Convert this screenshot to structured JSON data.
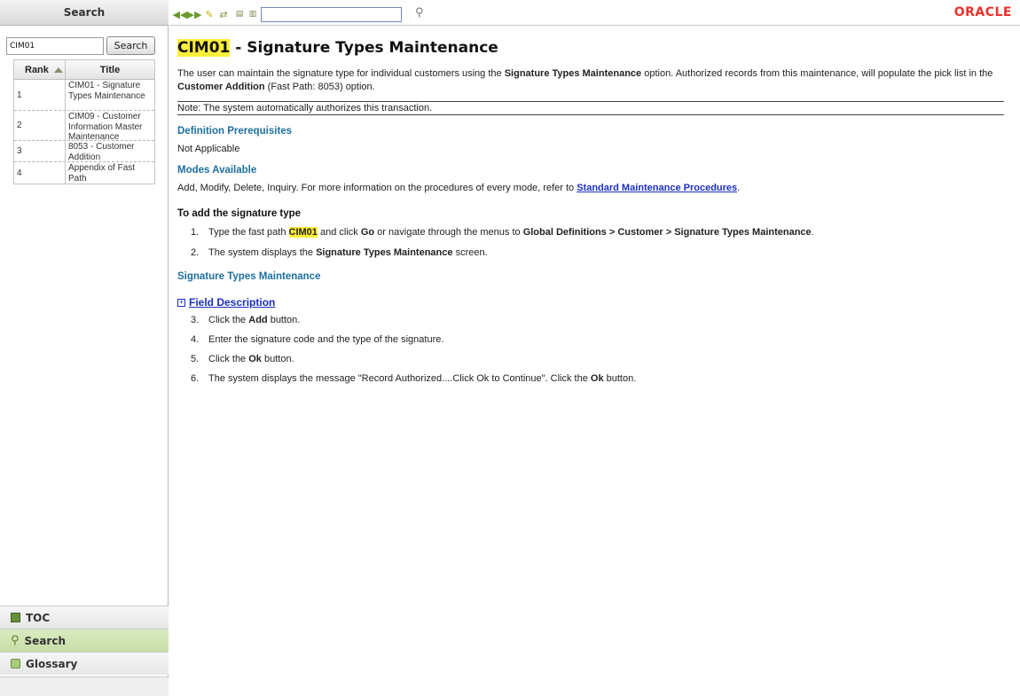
{
  "left_pane": {
    "header": "Search",
    "search_value": "CIM01",
    "search_button": "Search",
    "table": {
      "col_rank": "Rank",
      "col_title": "Title",
      "rows": [
        {
          "rank": "1",
          "title": "CIM01 - Signature Types Maintenance"
        },
        {
          "rank": "2",
          "title": "CIM09 - Customer Information Master Maintenance"
        },
        {
          "rank": "3",
          "title": "8053 - Customer Addition"
        },
        {
          "rank": "4",
          "title": "Appendix of Fast Path"
        }
      ]
    },
    "tabs": [
      {
        "label": "TOC",
        "active": false
      },
      {
        "label": "Search",
        "active": true
      },
      {
        "label": "Glossary",
        "active": false
      }
    ]
  },
  "toolbar": {
    "icons": [
      "previous-topic-icon",
      "next-topic-icon",
      "highlight-icon",
      "sync-toc-icon",
      "expand-icon",
      "collapse-icon",
      "find-icon"
    ],
    "find_value": "",
    "logo": "ORACLE",
    "logo_color": "#e8332a"
  },
  "content": {
    "title_code": "CIM01",
    "title_rest": " - Signature Types Maintenance",
    "intro": {
      "p1": "The user can maintain the signature type for individual customers using the ",
      "b1": "Signature Types Maintenance",
      "p2": " option. Authorized records from this maintenance, will populate the pick list in the ",
      "b2": "Customer Addition",
      "p3": " (Fast Path: 8053) option."
    },
    "note": "Note: The system automatically authorizes this transaction.",
    "prereq_heading": "Definition Prerequisites",
    "prereq_text": "Not Applicable",
    "modes_heading": "Modes Available",
    "modes_text": "Add, Modify, Delete, Inquiry. For more information on the procedures of every mode, refer to ",
    "modes_link": "Standard Maintenance Procedures",
    "modes_end": ".",
    "add_heading": "To add the signature type",
    "step1": {
      "num": "1.",
      "a": "Type the fast path ",
      "code": "CIM01",
      "b": " and click ",
      "go": "Go",
      "c": " or navigate through the menus to ",
      "path": "Global Definitions > Customer > Signature Types Maintenance",
      "d": "."
    },
    "step2": {
      "num": "2.",
      "a": "The system displays the ",
      "b": "Signature Types Maintenance",
      "c": " screen."
    },
    "sig_heading": "Signature Types Maintenance",
    "field_desc_link": "Field Description",
    "step3": {
      "num": "3.",
      "a": "Click the ",
      "b": "Add",
      "c": " button."
    },
    "step4": {
      "num": "4.",
      "a": "Enter the signature code and the type of the signature."
    },
    "step5": {
      "num": "5.",
      "a": "Click the ",
      "b": "Ok",
      "c": " button."
    },
    "step6": {
      "num": "6.",
      "a": "The system displays the message \"Record Authorized....Click Ok to Continue\". Click the ",
      "b": "Ok",
      "c": " button."
    }
  }
}
